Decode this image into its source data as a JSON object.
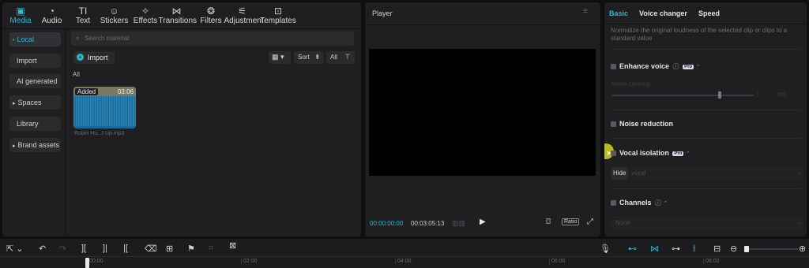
{
  "toolbar": {
    "tabs": [
      {
        "label": "Media",
        "icon": "media-icon",
        "glyph": "▣"
      },
      {
        "label": "Audio",
        "icon": "audio-icon",
        "glyph": "◔"
      },
      {
        "label": "Text",
        "icon": "text-icon",
        "glyph": "TI"
      },
      {
        "label": "Stickers",
        "icon": "stickers-icon",
        "glyph": "☺"
      },
      {
        "label": "Effects",
        "icon": "effects-icon",
        "glyph": "✧"
      },
      {
        "label": "Transitions",
        "icon": "transitions-icon",
        "glyph": "⋈"
      },
      {
        "label": "Filters",
        "icon": "filters-icon",
        "glyph": "❂"
      },
      {
        "label": "Adjustment",
        "icon": "adjustment-icon",
        "glyph": "⚟"
      },
      {
        "label": "Templates",
        "icon": "templates-icon",
        "glyph": "⊡"
      }
    ]
  },
  "sidebar": {
    "items": [
      {
        "label": "Local",
        "bullet": "•"
      },
      {
        "label": "Import",
        "bullet": ""
      },
      {
        "label": "AI generated",
        "bullet": ""
      },
      {
        "label": "Spaces",
        "bullet": "▸"
      },
      {
        "label": "Library",
        "bullet": ""
      },
      {
        "label": "Brand assets",
        "bullet": "▸"
      }
    ]
  },
  "media": {
    "search_placeholder": "Search material",
    "import_label": "Import",
    "sort_label": "Sort",
    "filter_label": "All",
    "section_label": "All",
    "clip": {
      "badge": "Added",
      "duration": "03:06",
      "name": "Robin Hu...t Up.mp3"
    }
  },
  "player": {
    "title": "Player",
    "current_time": "00:00:00:00",
    "total_time": "00:03:05:13",
    "ratio_label": "Ratio"
  },
  "inspector": {
    "tabs": [
      "Basic",
      "Voice changer",
      "Speed"
    ],
    "normalize_desc": "Normalize the original loudness of the selected clip or clips to a standard value",
    "enhance_voice": "Enhance voice",
    "pro_badge": "Pro",
    "noise_cleanup": "Noise cleanup",
    "slider_value": "0%",
    "noise_reduction": "Noise reduction",
    "vocal_isolation": "Vocal isolation",
    "hide_label": "Hide",
    "hide_value": "vocal",
    "channels": "Channels",
    "channels_value": "None"
  },
  "timeline": {
    "ticks": [
      "00:00",
      "02:00",
      "04:00",
      "06:00",
      "08:00"
    ]
  },
  "colors": {
    "accent": "#29b6d1",
    "panel": "#1f1f21",
    "background": "#0f0f10"
  }
}
